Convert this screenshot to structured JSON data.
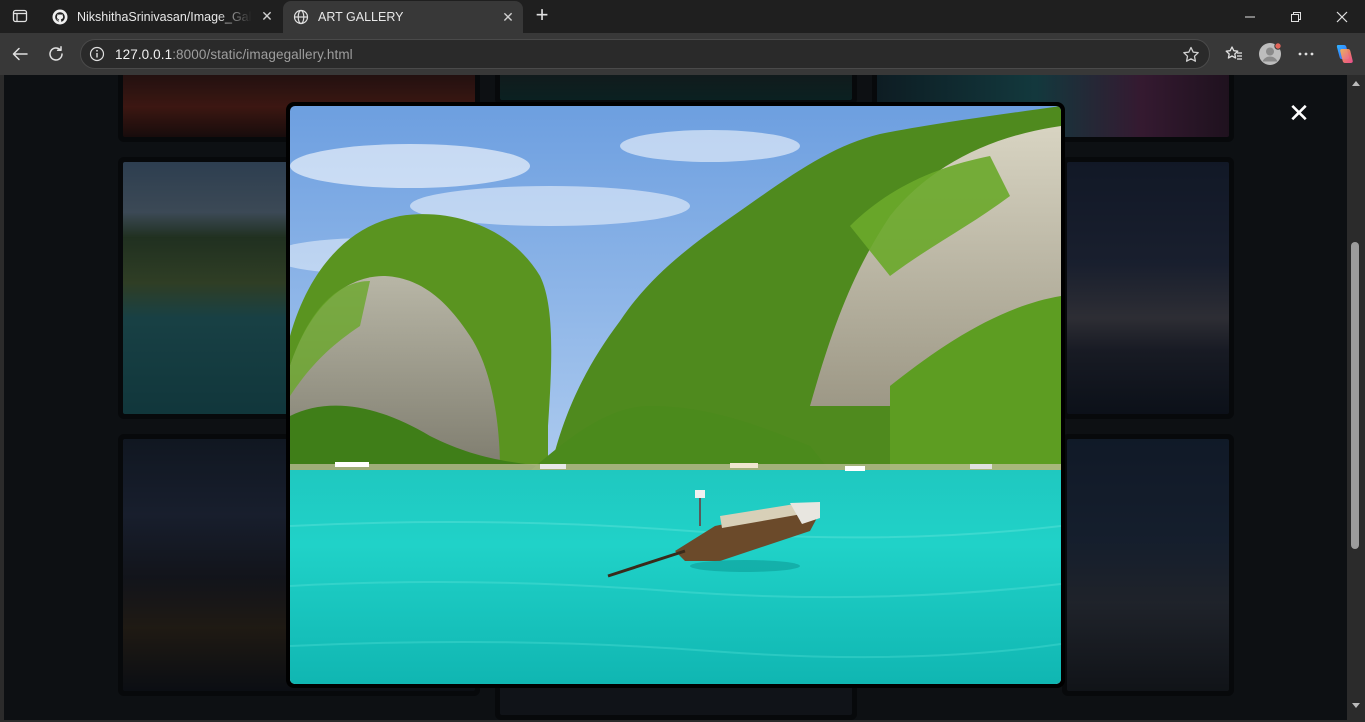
{
  "browser": {
    "tabs": [
      {
        "title": "NikshithaSrinivasan/Image_Gallery",
        "favicon": "github-icon",
        "active": false
      },
      {
        "title": "ART GALLERY",
        "favicon": "globe-icon",
        "active": true
      }
    ],
    "address": {
      "host": "127.0.0.1",
      "rest": ":8000/static/imagegallery.html"
    },
    "accent_color": "#383838"
  },
  "gallery": {
    "modal": {
      "close_symbol": "✕",
      "image_subject": "tropical bay with limestone cliffs and longtail boat"
    }
  }
}
